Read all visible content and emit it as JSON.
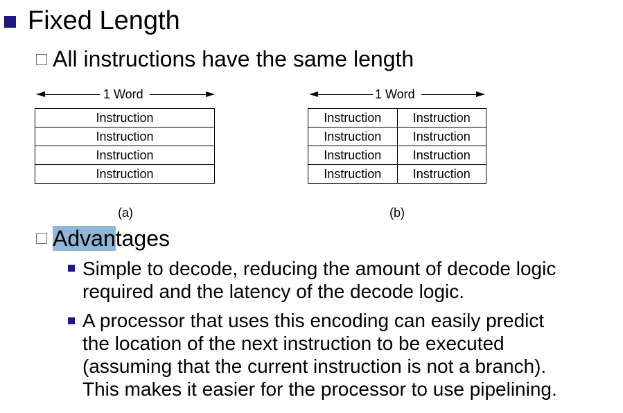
{
  "heading": "Fixed Length",
  "subheading": "All instructions have the same length",
  "figure_a": {
    "ruler_label": "1 Word",
    "rows": [
      "Instruction",
      "Instruction",
      "Instruction",
      "Instruction"
    ],
    "caption": "(a)"
  },
  "figure_b": {
    "ruler_label": "1 Word",
    "rows": [
      [
        "Instruction",
        "Instruction"
      ],
      [
        "Instruction",
        "Instruction"
      ],
      [
        "Instruction",
        "Instruction"
      ],
      [
        "Instruction",
        "Instruction"
      ]
    ],
    "caption": "(b)"
  },
  "advantages": {
    "title_highlighted": "Advan",
    "title_rest": "tages",
    "items": [
      {
        "lines": [
          "Simple to decode, reducing the amount of decode logic",
          "required and the latency of the decode logic."
        ]
      },
      {
        "lines": [
          "A processor that uses this encoding can easily predict",
          "the location of the next instruction to be executed",
          "(assuming that the current instruction is not a branch).",
          "This makes it easier for the processor to use pipelining."
        ]
      }
    ]
  },
  "colors": {
    "bullet": "#1a1a80",
    "highlight": "#8fb8d8"
  }
}
